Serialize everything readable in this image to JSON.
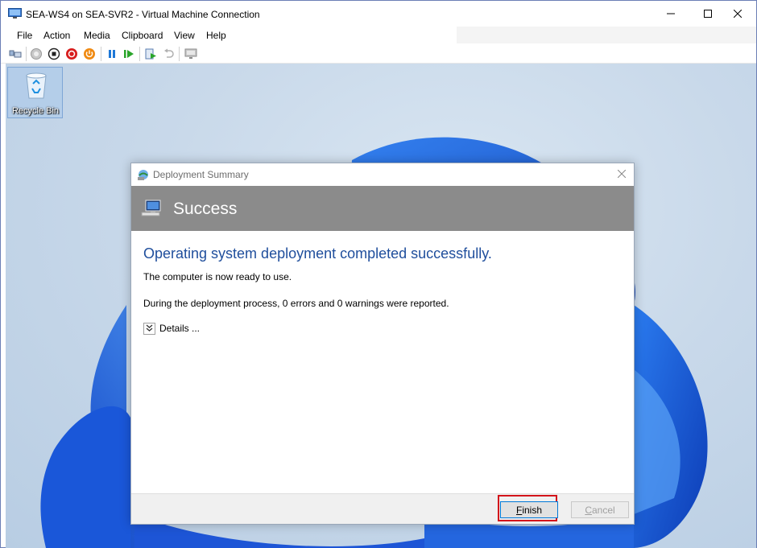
{
  "window": {
    "title": "SEA-WS4 on SEA-SVR2 - Virtual Machine Connection",
    "controls": [
      "minimize",
      "maximize",
      "close"
    ]
  },
  "menu": {
    "items": [
      "File",
      "Action",
      "Media",
      "Clipboard",
      "View",
      "Help"
    ]
  },
  "toolbar": {
    "icons": [
      "ctrl-alt-del-icon",
      "start-icon",
      "turn-off-icon",
      "shut-down-icon",
      "power-icon",
      "pause-icon",
      "resume-icon",
      "checkpoint-icon",
      "revert-icon",
      "enhanced-session-icon"
    ]
  },
  "desktop": {
    "recycle_bin_label": "Recycle Bin"
  },
  "dialog": {
    "title": "Deployment Summary",
    "banner_title": "Success",
    "headline": "Operating system deployment completed successfully.",
    "message_ready": "The computer is now ready to use.",
    "message_report": "During the deployment process, 0 errors and 0 warnings were reported.",
    "details_label": "Details ...",
    "finish_button": {
      "accel": "F",
      "rest": "inish"
    },
    "cancel_button": {
      "accel": "C",
      "rest": "ancel"
    }
  },
  "colors": {
    "headline": "#1f4e9c",
    "banner": "#8b8b8b",
    "highlight": "#d3141b",
    "desktop_accent": "#1f5fe0"
  }
}
